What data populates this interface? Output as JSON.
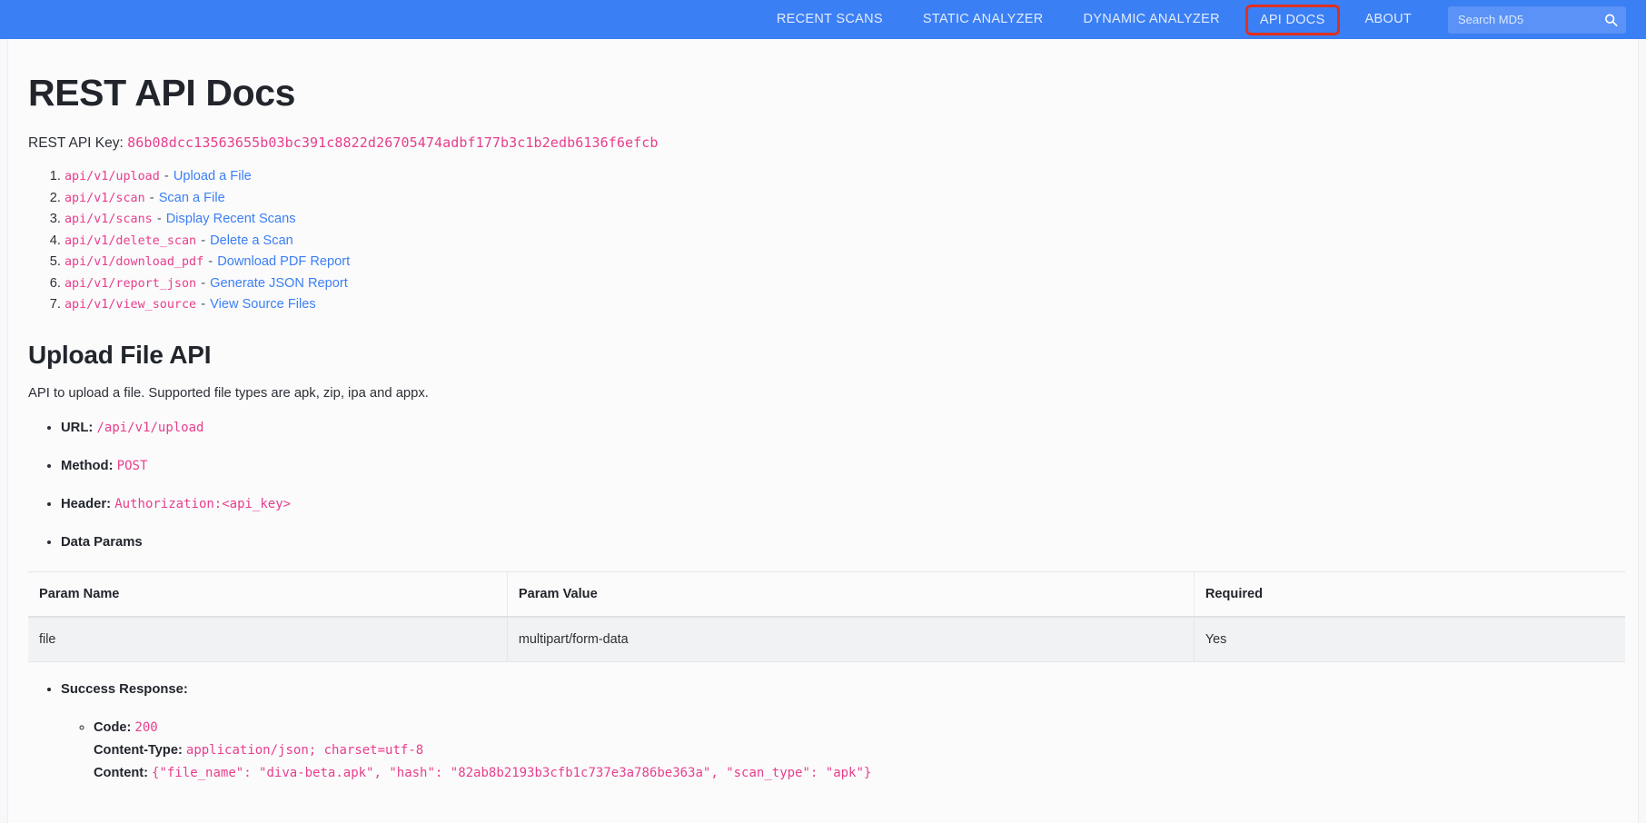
{
  "navbar": {
    "links": [
      {
        "label": "RECENT SCANS",
        "active": false
      },
      {
        "label": "STATIC ANALYZER",
        "active": false
      },
      {
        "label": "DYNAMIC ANALYZER",
        "active": false
      },
      {
        "label": "API DOCS",
        "active": true
      },
      {
        "label": "ABOUT",
        "active": false
      }
    ],
    "search": {
      "placeholder": "Search MD5",
      "value": "",
      "icon": "search-icon"
    },
    "background_color": "#3b7ff5",
    "highlight_color": "#e0301e"
  },
  "page": {
    "title": "REST API Docs",
    "api_key_label": "REST API Key:",
    "api_key": "86b08dcc13563655b03bc391c8822d26705474adbf177b3c1b2edb6136f6efcb",
    "endpoints": [
      {
        "path": "api/v1/upload",
        "separator": "-",
        "label": "Upload a File"
      },
      {
        "path": "api/v1/scan",
        "separator": "-",
        "label": "Scan a File"
      },
      {
        "path": "api/v1/scans",
        "separator": "-",
        "label": "Display Recent Scans"
      },
      {
        "path": "api/v1/delete_scan",
        "separator": "-",
        "label": "Delete a Scan"
      },
      {
        "path": "api/v1/download_pdf",
        "separator": "-",
        "label": "Download PDF Report"
      },
      {
        "path": "api/v1/report_json",
        "separator": "-",
        "label": "Generate JSON Report"
      },
      {
        "path": "api/v1/view_source",
        "separator": "-",
        "label": "View Source Files"
      }
    ]
  },
  "upload_section": {
    "title": "Upload File API",
    "description": "API to upload a file. Supported file types are apk, zip, ipa and appx.",
    "params": [
      {
        "label": "URL:",
        "value": "/api/v1/upload",
        "mono": true
      },
      {
        "label": "Method:",
        "value": "POST",
        "mono": true
      },
      {
        "label": "Header:",
        "value": "Authorization:<api_key>",
        "mono": true
      },
      {
        "label": "Data Params",
        "value": "",
        "mono": false
      }
    ],
    "table": {
      "headers": [
        "Param Name",
        "Param Value",
        "Required"
      ],
      "rows": [
        [
          "file",
          "multipart/form-data",
          "Yes"
        ]
      ]
    },
    "success_response": {
      "label": "Success Response:",
      "code_label": "Code:",
      "code_value": "200",
      "content_type_label": "Content-Type:",
      "content_type_value": "application/json; charset=utf-8",
      "content_label": "Content:",
      "content_value": "{\"file_name\": \"diva-beta.apk\", \"hash\": \"82ab8b2193b3cfb1c737e3a786be363a\", \"scan_type\": \"apk\"}"
    }
  }
}
